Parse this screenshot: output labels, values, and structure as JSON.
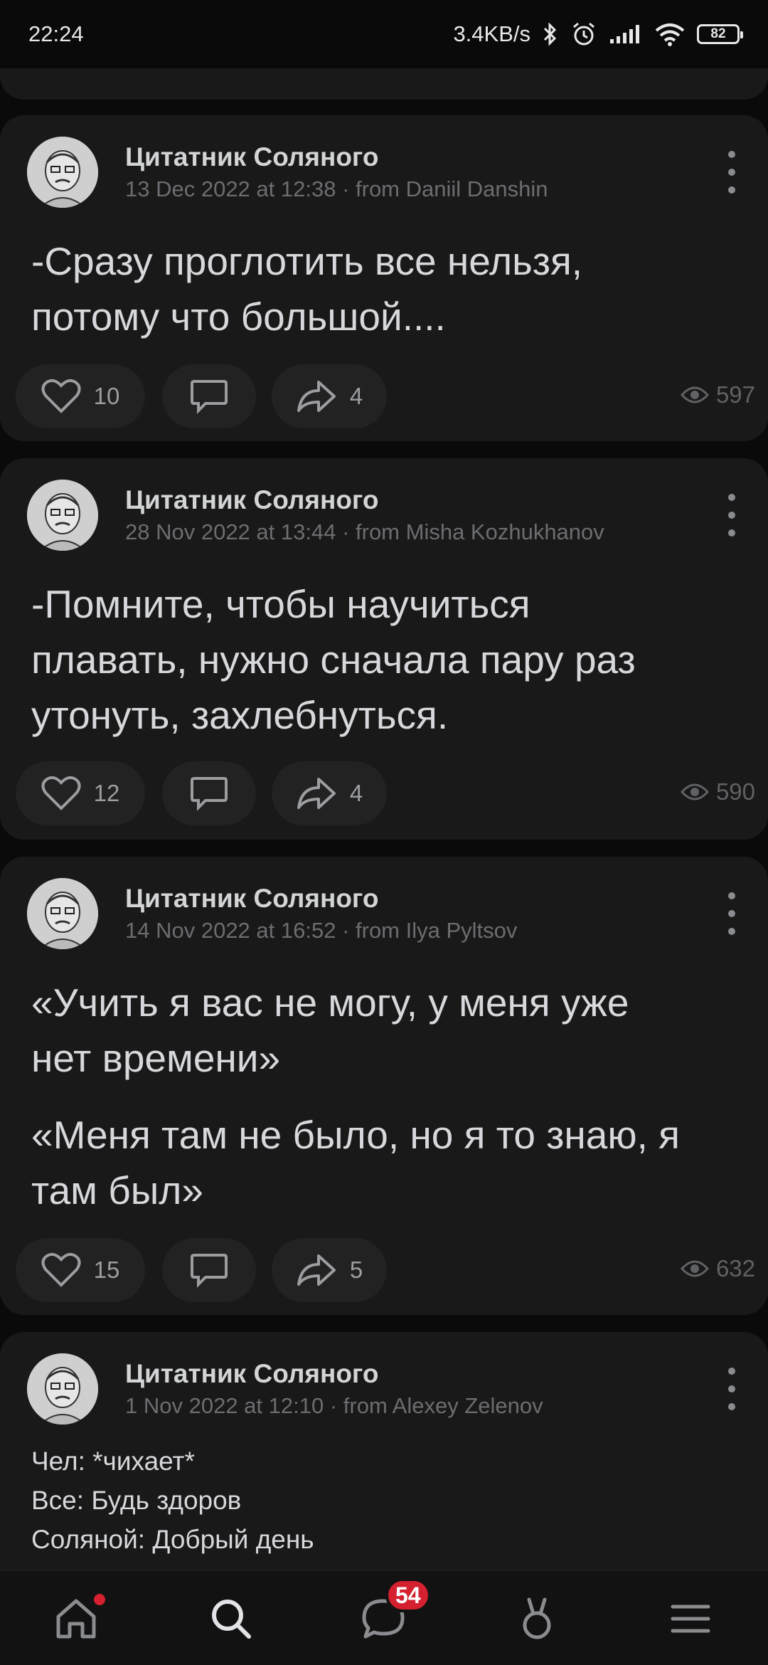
{
  "status_bar": {
    "time": "22:24",
    "network_speed": "3.4KB/s",
    "battery": "82"
  },
  "colors": {
    "background": "#0a0a0a",
    "card": "#191919",
    "accent_red": "#d4202f"
  },
  "posts": [
    {
      "author": "Цитатник Соляного",
      "meta": "13 Dec 2022 at 12:38 · from Daniil Danshin",
      "text_lines": [
        "-Сразу проглотить все нельзя,",
        "потому что большой...."
      ],
      "likes": "10",
      "shares": "4",
      "views": "597"
    },
    {
      "author": "Цитатник Соляного",
      "meta": "28 Nov 2022 at 13:44 · from Misha Kozhukhanov",
      "text_lines": [
        "-Помните, чтобы научиться",
        "плавать, нужно сначала пару раз",
        "утонуть, захлебнуться."
      ],
      "likes": "12",
      "shares": "4",
      "views": "590"
    },
    {
      "author": "Цитатник Соляного",
      "meta": "14 Nov 2022 at 16:52 · from Ilya Pyltsov",
      "text_lines": [
        "«Учить я вас не могу, у меня уже",
        "нет времени»"
      ],
      "text_lines_2": [
        "«Меня там не было, но я то знаю, я",
        "там был»"
      ],
      "likes": "15",
      "shares": "5",
      "views": "632"
    },
    {
      "author": "Цитатник Соляного",
      "meta": "1 Nov 2022 at 12:10 · from Alexey Zelenov",
      "text_lines": [
        "Чел: *чихает*",
        "Все: Будь здоров",
        "Соляной: Добрый день"
      ]
    }
  ],
  "tab_bar": {
    "items": [
      "home-icon",
      "search-icon",
      "messages-icon",
      "clips-icon",
      "menu-icon"
    ],
    "messages_badge": "54"
  }
}
